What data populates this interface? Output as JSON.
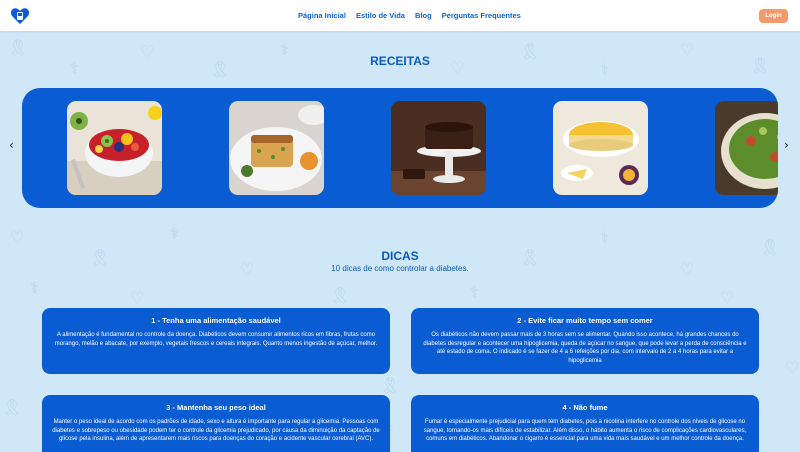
{
  "header": {
    "nav": [
      "Página Inicial",
      "Estilo de Vida",
      "Blog",
      "Perguntas Frequentes"
    ],
    "login_label": "Login"
  },
  "recipes": {
    "title": "RECEITAS",
    "prev_arrow": "‹",
    "next_arrow": "›"
  },
  "tips": {
    "title": "DICAS",
    "subtitle": "10 dicas de como controlar a diabetes.",
    "items": [
      {
        "title": "1 - Tenha uma alimentação saudável",
        "text": "A alimentação é fundamental no controle da doença. Diabéticos devem consumir alimentos ricos em fibras, frutas como morango, melão e abacate, por exemplo, vegetais frescos e cereais integrais. Quanto menos ingestão de açúcar, melhor."
      },
      {
        "title": "2 - Evite ficar muito tempo sem comer",
        "text": "Os diabéticos não devem passar mais de 3 horas sem se alimentar. Quando isso acontece, há grandes chances do diabetes desregular e acontecer uma hipoglicemia, queda de açúcar no sangue, que pode levar a perda de consciência e até estado de coma. O indicado é se fazer de 4 a 6 refeições por dia, com intervalo de 2 a 4 horas para evitar a hipoglicemia"
      },
      {
        "title": "3 - Mantenha seu peso ideal",
        "text": "Manter o peso ideal de acordo com os padrões de idade, sexo e altura é importante para regular a glicemia. Pessoas com diabetes e sobrepeso ou obesidade podem ter o controle da glicemia prejudicado, por causa da diminuição da captação de glicose pela insulina, além de apresentarem mais riscos para doenças do coração e acidente vascular cerebral (AVC)."
      },
      {
        "title": "4 - Não fume",
        "text": "Fumar é especialmente prejudicial para quem tem diabetes, pois a nicotina interfere no controle dos níveis de glicose no sangue, tornando-os mais difíceis de estabilizar. Além disso, o hábito aumenta o risco de complicações cardiovasculares, comuns em diabéticos. Abandonar o cigarro é essencial para uma vida mais saudável e um melhor controle da doença."
      }
    ]
  },
  "colors": {
    "brand_blue": "#0a5cd2",
    "background": "#cfe7f7",
    "login_orange": "#f39a6c"
  }
}
